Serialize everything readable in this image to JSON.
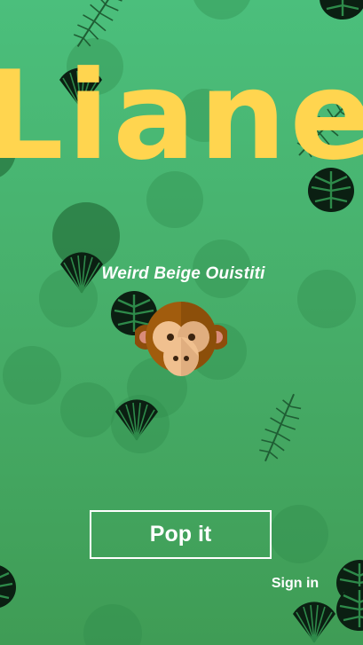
{
  "app": {
    "logo_text": "Liane",
    "logo_color": "#ffd54f"
  },
  "profile": {
    "generated_name": "Weird Beige Ouistiti",
    "avatar_icon": "monkey-face-icon"
  },
  "actions": {
    "primary_label": "Pop it",
    "secondary_label": "Sign in"
  },
  "decor": {
    "leaf_color": "#0b1f12",
    "circle_color": "#2f8a4a"
  }
}
